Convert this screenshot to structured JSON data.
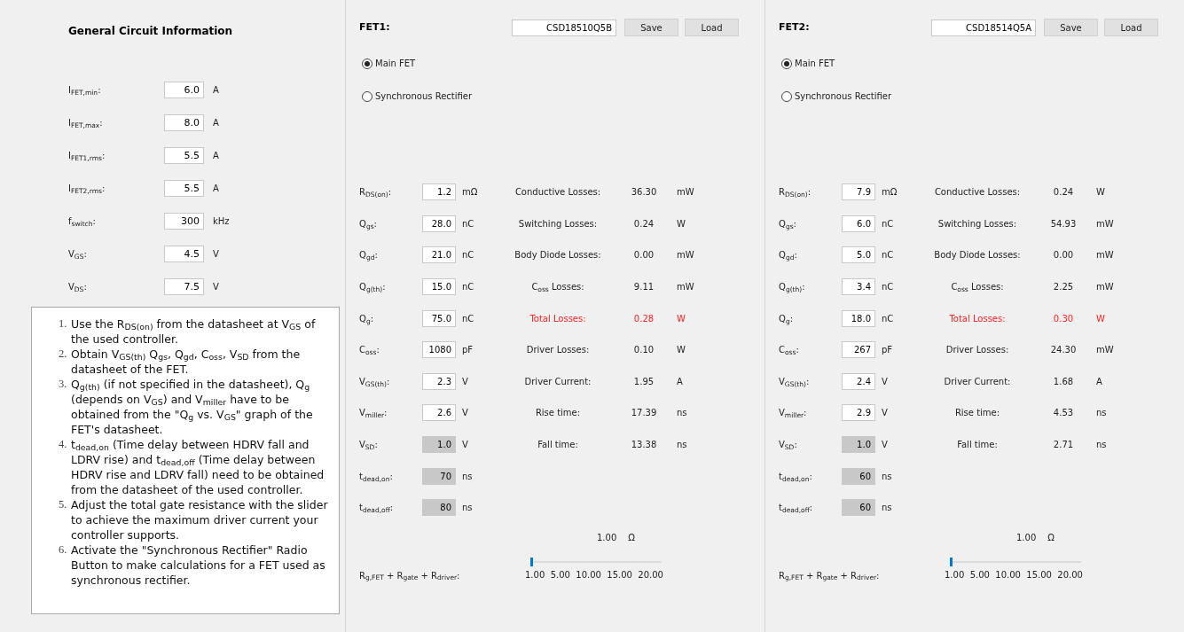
{
  "general": {
    "title": "General Circuit Information",
    "params": [
      {
        "label": "I$_{FET,min}$:",
        "value": "6.0",
        "unit": "A"
      },
      {
        "label": "I$_{FET,max}$:",
        "value": "8.0",
        "unit": "A"
      },
      {
        "label": "I$_{FET1,rms}$:",
        "value": "5.5",
        "unit": "A"
      },
      {
        "label": "I$_{FET2,rms}$:",
        "value": "5.5",
        "unit": "A"
      },
      {
        "label": "f$_{switch}$:",
        "value": "300",
        "unit": "kHz"
      },
      {
        "label": "V$_{GS}$:",
        "value": "4.5",
        "unit": "V"
      },
      {
        "label": "V$_{DS}$:",
        "value": "7.5",
        "unit": "V"
      }
    ],
    "notes": [
      {
        "number": "1.",
        "text": "Use the R$_{DS(on)}$ from the datasheet at V$_{GS}$ of the used controller."
      },
      {
        "number": "2.",
        "text": "Obtain V$_{GS(th)}$ Q$_{gs}$, Q$_{gd}$, C$_{oss}$, V$_{SD}$ from the datasheet of the FET."
      },
      {
        "number": "3.",
        "text": "Q$_{g(th)}$ (if not specified in the datasheet), Q$_{g}$ (depends on V$_{GS}$) and V$_{miller}$ have to be obtained from the \"Q$_{g}$ vs. V$_{GS}$\" graph of the FET's datasheet."
      },
      {
        "number": "4.",
        "text": "t$_{dead,on}$ (Time delay between HDRV fall and LDRV rise) and t$_{dead,off}$ (Time delay between HDRV rise and LDRV fall) need to be obtained from the datasheet of the used controller."
      },
      {
        "number": "5.",
        "text": "Adjust the total gate resistance with the slider to achieve the maximum driver current your controller supports."
      },
      {
        "number": "6.",
        "text": "Activate the \"Synchronous Rectifier\" Radio Button to make calculations for a FET used as synchronous rectifier."
      }
    ]
  },
  "fets": [
    {
      "title": "FET1:",
      "part_number": "CSD18510Q5B",
      "buttons": [
        "Save",
        "Load"
      ],
      "modes": [
        {
          "label": "Main FET",
          "selected": true
        },
        {
          "label": "Synchronous Rectifier",
          "selected": false
        }
      ],
      "params": [
        {
          "label": "R$_{DS(on)}$:",
          "value": "1.2",
          "unit": "mΩ",
          "disabled": false
        },
        {
          "label": "Q$_{gs}$:",
          "value": "28.0",
          "unit": "nC",
          "disabled": false
        },
        {
          "label": "Q$_{gd}$:",
          "value": "21.0",
          "unit": "nC",
          "disabled": false
        },
        {
          "label": "Q$_{g(th)}$:",
          "value": "15.0",
          "unit": "nC",
          "disabled": false
        },
        {
          "label": "Q$_{g}$:",
          "value": "75.0",
          "unit": "nC",
          "disabled": false
        },
        {
          "label": "C$_{oss}$:",
          "value": "1080",
          "unit": "pF",
          "disabled": false
        },
        {
          "label": "V$_{GS(th)}$:",
          "value": "2.3",
          "unit": "V",
          "disabled": false
        },
        {
          "label": "V$_{miller}$:",
          "value": "2.6",
          "unit": "V",
          "disabled": false
        },
        {
          "label": "V$_{SD}$:",
          "value": "1.0",
          "unit": "V",
          "disabled": true
        },
        {
          "label": "t$_{dead,on}$:",
          "value": "70",
          "unit": "ns",
          "disabled": true
        },
        {
          "label": "t$_{dead,off}$:",
          "value": "80",
          "unit": "ns",
          "disabled": true
        }
      ],
      "results": [
        {
          "label": "Conductive Losses:",
          "value": "36.30",
          "unit": "mW",
          "highlight": false
        },
        {
          "label": "Switching Losses:",
          "value": "0.24",
          "unit": "W",
          "highlight": false
        },
        {
          "label": "Body Diode Losses:",
          "value": "0.00",
          "unit": "mW",
          "highlight": false
        },
        {
          "label": "C$_{oss}$ Losses:",
          "value": "9.11",
          "unit": "mW",
          "highlight": false
        },
        {
          "label": "Total Losses:",
          "value": "0.28",
          "unit": "W",
          "highlight": true
        },
        {
          "label": "Driver Losses:",
          "value": "0.10",
          "unit": "W",
          "highlight": false
        },
        {
          "label": "Driver Current:",
          "value": "1.95",
          "unit": "A",
          "highlight": false
        },
        {
          "label": "Rise time:",
          "value": "17.39",
          "unit": "ns",
          "highlight": false
        },
        {
          "label": "Fall time:",
          "value": "13.38",
          "unit": "ns",
          "highlight": false
        }
      ],
      "resistance": {
        "value": "1.00",
        "unit": "Ω",
        "label": "R$_{g,FET}$ + R$_{gate}$ + R$_{driver}$:",
        "level": 0,
        "ticks": [
          "1.00",
          "5.00",
          "10.00",
          "15.00",
          "20.00"
        ]
      }
    },
    {
      "title": "FET2:",
      "part_number": "CSD18514Q5A",
      "buttons": [
        "Save",
        "Load"
      ],
      "modes": [
        {
          "label": "Main FET",
          "selected": true
        },
        {
          "label": "Synchronous Rectifier",
          "selected": false
        }
      ],
      "params": [
        {
          "label": "R$_{DS(on)}$:",
          "value": "7.9",
          "unit": "mΩ",
          "disabled": false
        },
        {
          "label": "Q$_{gs}$:",
          "value": "6.0",
          "unit": "nC",
          "disabled": false
        },
        {
          "label": "Q$_{gd}$:",
          "value": "5.0",
          "unit": "nC",
          "disabled": false
        },
        {
          "label": "Q$_{g(th)}$:",
          "value": "3.4",
          "unit": "nC",
          "disabled": false
        },
        {
          "label": "Q$_{g}$:",
          "value": "18.0",
          "unit": "nC",
          "disabled": false
        },
        {
          "label": "C$_{oss}$:",
          "value": "267",
          "unit": "pF",
          "disabled": false
        },
        {
          "label": "V$_{GS(th)}$:",
          "value": "2.4",
          "unit": "V",
          "disabled": false
        },
        {
          "label": "V$_{miller}$:",
          "value": "2.9",
          "unit": "V",
          "disabled": false
        },
        {
          "label": "V$_{SD}$:",
          "value": "1.0",
          "unit": "V",
          "disabled": true
        },
        {
          "label": "t$_{dead,on}$:",
          "value": "60",
          "unit": "ns",
          "disabled": true
        },
        {
          "label": "t$_{dead,off}$:",
          "value": "60",
          "unit": "ns",
          "disabled": true
        }
      ],
      "results": [
        {
          "label": "Conductive Losses:",
          "value": "0.24",
          "unit": "W",
          "highlight": false
        },
        {
          "label": "Switching Losses:",
          "value": "54.93",
          "unit": "mW",
          "highlight": false
        },
        {
          "label": "Body Diode Losses:",
          "value": "0.00",
          "unit": "mW",
          "highlight": false
        },
        {
          "label": "C$_{oss}$ Losses:",
          "value": "2.25",
          "unit": "mW",
          "highlight": false
        },
        {
          "label": "Total Losses:",
          "value": "0.30",
          "unit": "W",
          "highlight": true
        },
        {
          "label": "Driver Losses:",
          "value": "24.30",
          "unit": "mW",
          "highlight": false
        },
        {
          "label": "Driver Current:",
          "value": "1.68",
          "unit": "A",
          "highlight": false
        },
        {
          "label": "Rise time:",
          "value": "4.53",
          "unit": "ns",
          "highlight": false
        },
        {
          "label": "Fall time:",
          "value": "2.71",
          "unit": "ns",
          "highlight": false
        }
      ],
      "resistance": {
        "value": "1.00",
        "unit": "Ω",
        "label": "R$_{g,FET}$ + R$_{gate}$ + R$_{driver}$:",
        "level": 0,
        "ticks": [
          "1.00",
          "5.00",
          "10.00",
          "15.00",
          "20.00"
        ]
      }
    }
  ]
}
